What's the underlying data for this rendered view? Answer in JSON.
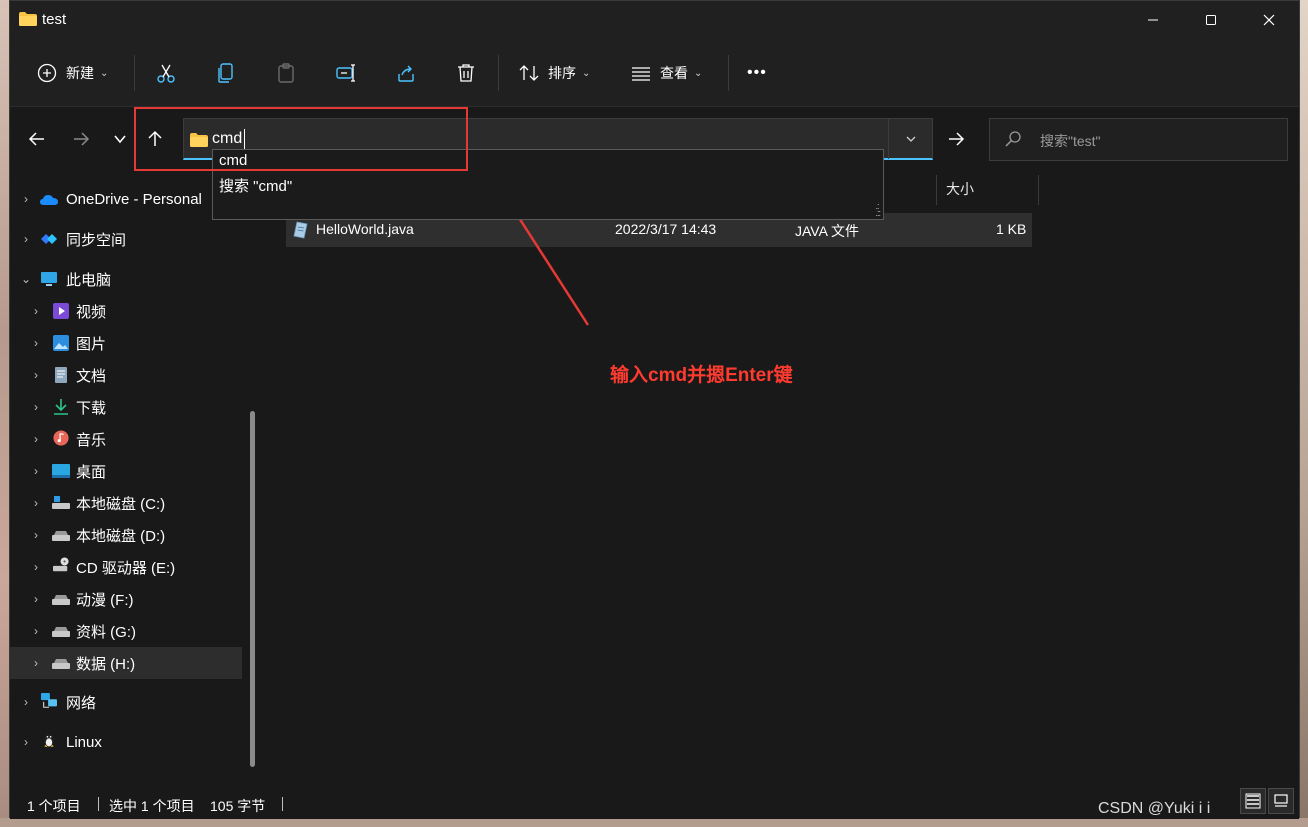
{
  "window": {
    "title": "test"
  },
  "toolbar": {
    "new_label": "新建",
    "sort_label": "排序",
    "view_label": "查看",
    "more_label": "•••"
  },
  "address": {
    "value": "cmd",
    "suggestions": [
      "cmd",
      "搜索 \"cmd\""
    ]
  },
  "search": {
    "placeholder": "搜索\"test\""
  },
  "sidebar": {
    "items": [
      {
        "label": "OneDrive - Personal",
        "icon": "onedrive-cloud-icon"
      },
      {
        "label": "同步空间",
        "icon": "sync-space-icon"
      },
      {
        "label": "此电脑",
        "icon": "this-pc-icon"
      },
      {
        "label": "视频",
        "icon": "videos-icon"
      },
      {
        "label": "图片",
        "icon": "pictures-icon"
      },
      {
        "label": "文档",
        "icon": "documents-icon"
      },
      {
        "label": "下载",
        "icon": "downloads-icon"
      },
      {
        "label": "音乐",
        "icon": "music-icon"
      },
      {
        "label": "桌面",
        "icon": "desktop-icon"
      },
      {
        "label": "本地磁盘 (C:)",
        "icon": "system-drive-icon"
      },
      {
        "label": "本地磁盘 (D:)",
        "icon": "drive-icon"
      },
      {
        "label": "CD 驱动器 (E:)",
        "icon": "cd-drive-icon"
      },
      {
        "label": "动漫 (F:)",
        "icon": "drive-icon"
      },
      {
        "label": "资料 (G:)",
        "icon": "drive-icon"
      },
      {
        "label": "数据 (H:)",
        "icon": "drive-icon"
      },
      {
        "label": "网络",
        "icon": "network-icon"
      },
      {
        "label": "Linux",
        "icon": "linux-penguin-icon"
      }
    ]
  },
  "columns": {
    "size": "大小"
  },
  "files": [
    {
      "name": "HelloWorld.java",
      "modified": "2022/3/17 14:43",
      "type": "JAVA 文件",
      "size": "1 KB"
    }
  ],
  "annotation": {
    "text": "输入cmd并摁Enter键"
  },
  "status": {
    "count": "1 个项目",
    "selected": "选中 1 个项目",
    "size": "105 字节"
  },
  "watermark": "CSDN @Yuki i i",
  "colors": {
    "accent": "#4cc2ff",
    "annotation_red": "#e53935",
    "folder_yellow": "#f6c343",
    "background": "#191919"
  }
}
